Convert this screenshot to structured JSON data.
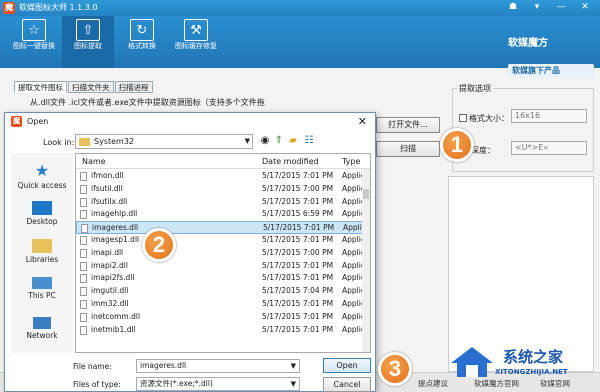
{
  "app": {
    "title": "软媒图标大师 1.1.3.0",
    "brand": "软媒魔方",
    "brand_sub": "软媒旗下产品",
    "toolbar": [
      {
        "label": "图标一键替换",
        "icon": "star-icon"
      },
      {
        "label": "图标提取",
        "icon": "up-arrow-icon"
      },
      {
        "label": "格式转换",
        "icon": "refresh-icon"
      },
      {
        "label": "图标缓存修复",
        "icon": "wrench-icon"
      }
    ],
    "tabs": [
      "提取文件图标",
      "扫描文件夹",
      "扫描进程"
    ],
    "hint": "从.dll文件 .icl文件或者.exe文件中提取资源图标（支持多个文件拖",
    "open_file_button": "打开文件...",
    "scan_button": "扫描",
    "options": {
      "title": "提取选项",
      "size_label": "格式大小：",
      "size_value": "16x16",
      "depth_label": "深度：",
      "depth_value": "<U*>E«"
    },
    "status": {
      "suggest": "提点建议",
      "official1": "软媒魔方官网",
      "official2": "软媒官网"
    }
  },
  "dialog": {
    "title": "Open",
    "look_in_label": "Look in:",
    "look_in_value": "System32",
    "columns": {
      "name": "Name",
      "date": "Date modified",
      "type": "Type"
    },
    "files": [
      {
        "name": "ifmon.dll",
        "date": "5/17/2015 7:01 PM",
        "type": "Applic"
      },
      {
        "name": "ifsutil.dll",
        "date": "5/17/2015 7:00 PM",
        "type": "Applic"
      },
      {
        "name": "ifsutilx.dll",
        "date": "5/17/2015 7:01 PM",
        "type": "Applic"
      },
      {
        "name": "imagehlp.dll",
        "date": "5/17/2015 6:59 PM",
        "type": "Applic"
      },
      {
        "name": "imageres.dll",
        "date": "5/17/2015 7:01 PM",
        "type": "Applic"
      },
      {
        "name": "imagesp1.dll",
        "date": "5/17/2015 7:01 PM",
        "type": "Applic"
      },
      {
        "name": "imapi.dll",
        "date": "5/17/2015 7:00 PM",
        "type": "Applic"
      },
      {
        "name": "imapi2.dll",
        "date": "5/17/2015 7:01 PM",
        "type": "Applic"
      },
      {
        "name": "imapi2fs.dll",
        "date": "5/17/2015 7:01 PM",
        "type": "Applic"
      },
      {
        "name": "imgutil.dll",
        "date": "5/17/2015 7:04 PM",
        "type": "Applic"
      },
      {
        "name": "imm32.dll",
        "date": "5/17/2015 7:01 PM",
        "type": "Applic"
      },
      {
        "name": "inetcomm.dll",
        "date": "5/17/2015 7:01 PM",
        "type": "Applic"
      },
      {
        "name": "inetmib1.dll",
        "date": "5/17/2015 7:01 PM",
        "type": "Applic"
      }
    ],
    "selected_index": 4,
    "places": [
      "Quick access",
      "Desktop",
      "Libraries",
      "This PC",
      "Network"
    ],
    "file_name_label": "File name:",
    "file_name_value": "imageres.dll",
    "file_type_label": "Files of type:",
    "file_type_value": "资源文件(*.exe;*.dll)",
    "open_button": "Open",
    "cancel_button": "Cancel"
  },
  "callouts": [
    "1",
    "2",
    "3"
  ],
  "watermark": {
    "text": "系统之家",
    "url": "XITONGZHIJIA.NET"
  }
}
